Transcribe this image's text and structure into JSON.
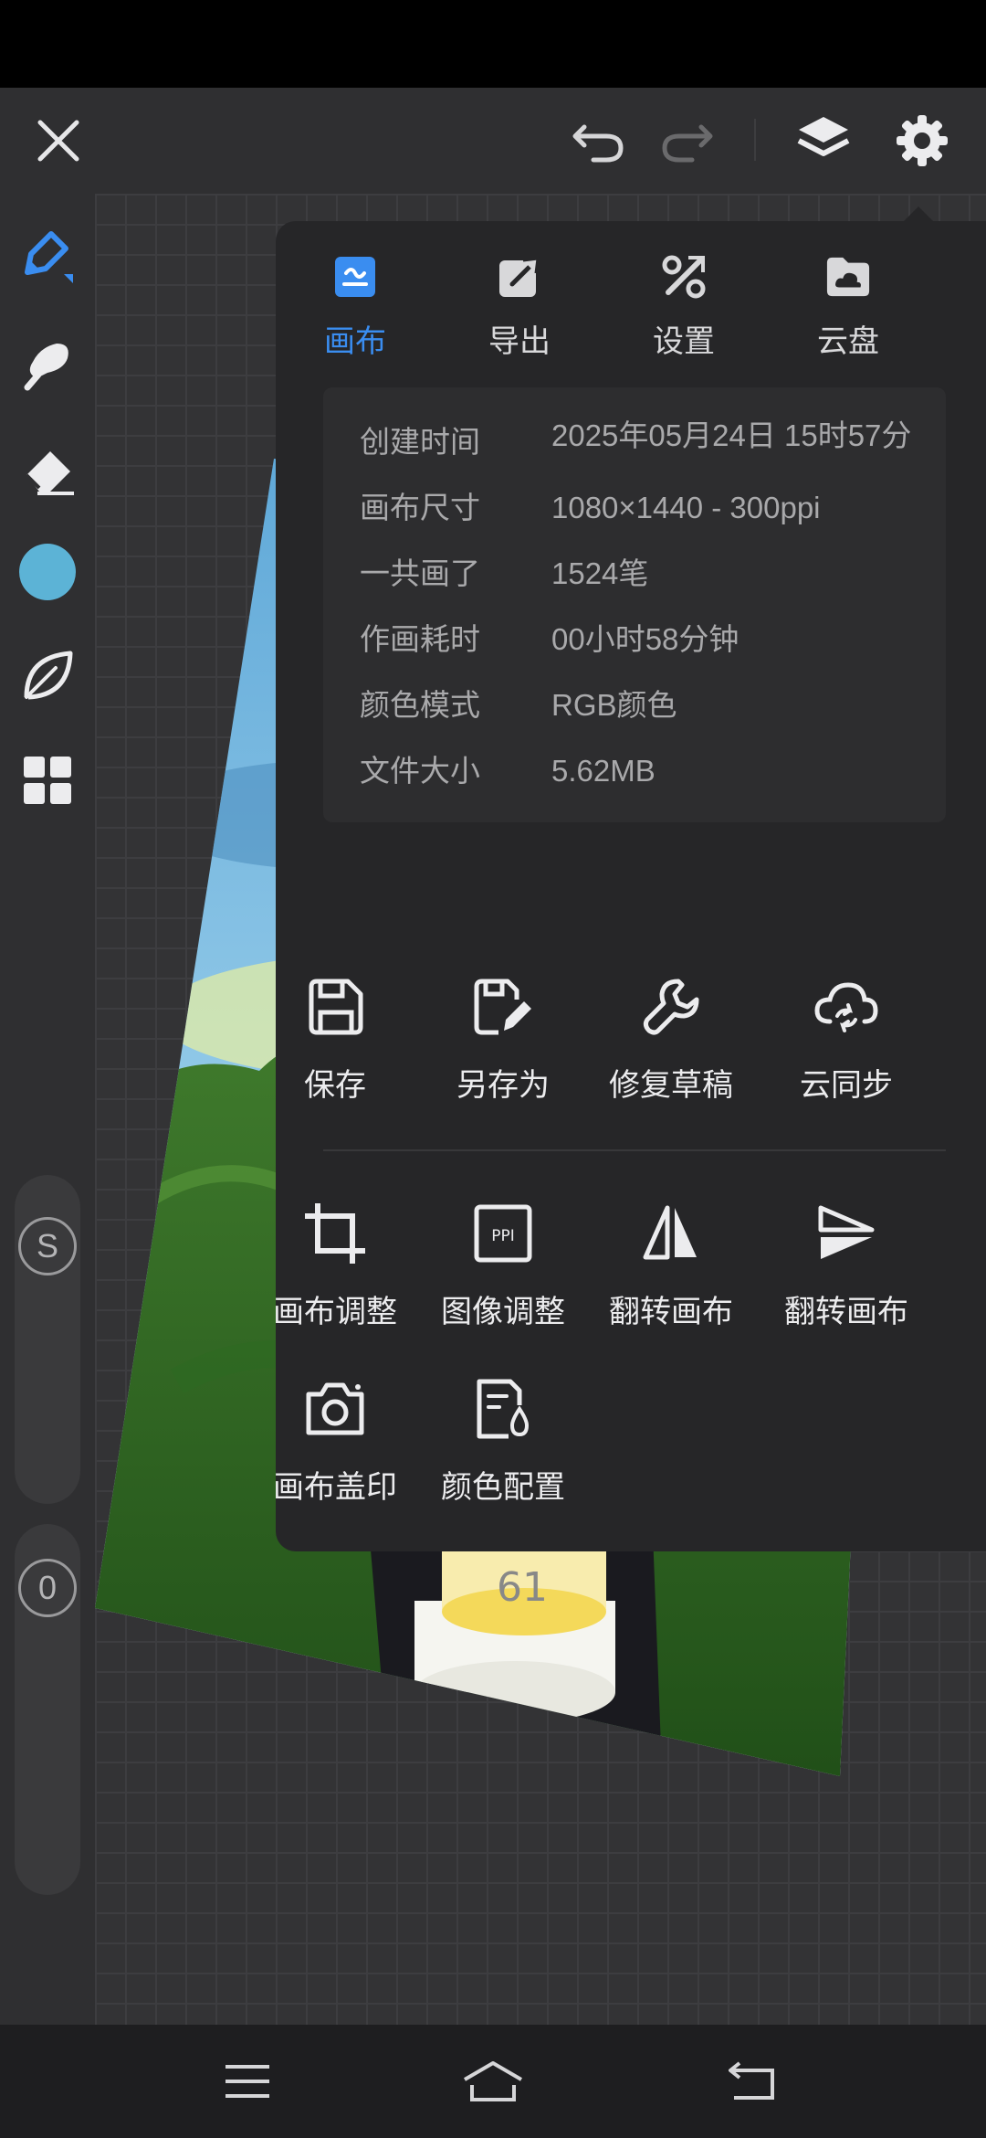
{
  "colors": {
    "accent": "#3a8df0",
    "brush_color": "#5cb3d6",
    "popup_bg": "#262628",
    "app_bg": "#2f2f31"
  },
  "topbar": {
    "icons": [
      "close-icon",
      "undo-icon",
      "redo-icon",
      "layers-icon",
      "gear-icon"
    ]
  },
  "leftbar": {
    "tools": [
      "brush-pen-icon",
      "smudge-icon",
      "eraser-icon",
      "color-swatch",
      "leaf-icon",
      "grid-icon"
    ],
    "size_slider_label": "S",
    "opacity_slider_label": "0"
  },
  "popup": {
    "tabs": [
      {
        "label": "画布",
        "icon": "canvas-icon",
        "active": true
      },
      {
        "label": "导出",
        "icon": "export-icon",
        "active": false
      },
      {
        "label": "设置",
        "icon": "tools-icon",
        "active": false
      },
      {
        "label": "云盘",
        "icon": "cloud-folder-icon",
        "active": false
      }
    ],
    "info": [
      {
        "key": "创建时间",
        "value": "2025年05月24日  15时57分"
      },
      {
        "key": "画布尺寸",
        "value": "1080×1440  -  300ppi"
      },
      {
        "key": "一共画了",
        "value": "1524笔"
      },
      {
        "key": "作画耗时",
        "value": "00小时58分钟"
      },
      {
        "key": "颜色模式",
        "value": "RGB颜色"
      },
      {
        "key": "文件大小",
        "value": "5.62MB"
      }
    ],
    "actions_row1": [
      {
        "label": "保存",
        "icon": "save-icon"
      },
      {
        "label": "另存为",
        "icon": "save-as-icon"
      },
      {
        "label": "修复草稿",
        "icon": "wrench-icon"
      },
      {
        "label": "云同步",
        "icon": "cloud-sync-icon"
      }
    ],
    "actions_row2": [
      {
        "label": "画布调整",
        "icon": "crop-icon"
      },
      {
        "label": "图像调整",
        "icon": "ppi-icon",
        "badge": "PPI"
      },
      {
        "label": "翻转画布",
        "icon": "flip-horizontal-icon"
      },
      {
        "label": "翻转画布",
        "icon": "flip-vertical-icon"
      }
    ],
    "actions_row3": [
      {
        "label": "画布盖印",
        "icon": "camera-icon"
      },
      {
        "label": "颜色配置",
        "icon": "color-profile-icon"
      }
    ]
  },
  "navbar": {
    "icons": [
      "menu-icon",
      "home-icon",
      "back-icon"
    ]
  }
}
